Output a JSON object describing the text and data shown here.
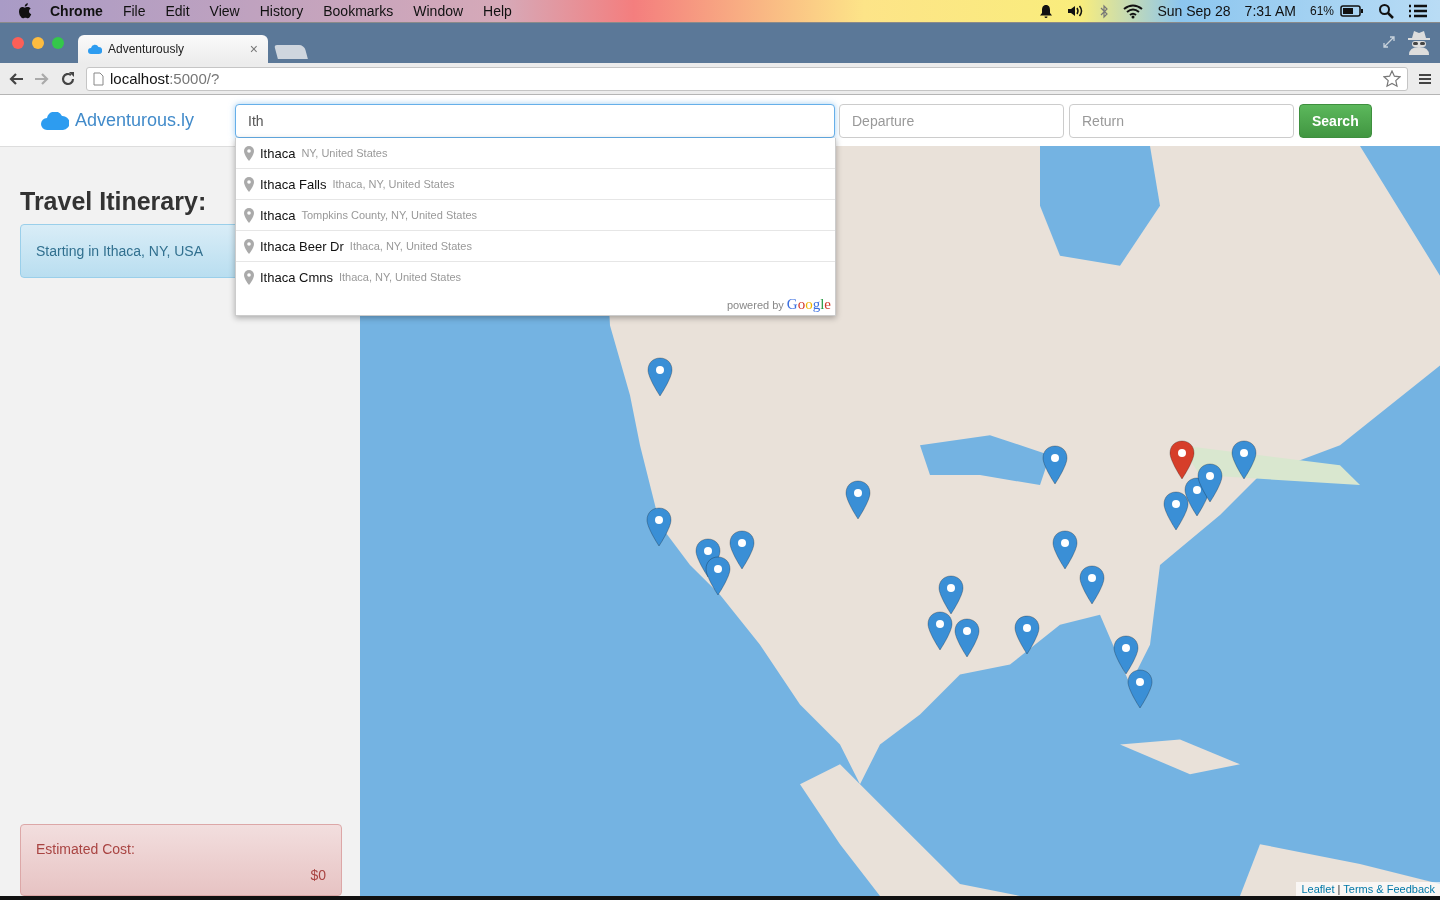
{
  "menu_bar": {
    "app": "Chrome",
    "items": [
      "File",
      "Edit",
      "View",
      "History",
      "Bookmarks",
      "Window",
      "Help"
    ],
    "date": "Sun Sep 28",
    "time": "7:31 AM",
    "battery": "61%"
  },
  "browser": {
    "tab": {
      "title": "Adventurously",
      "close": "×"
    },
    "url_host": "localhost",
    "url_path": ":5000/?"
  },
  "header": {
    "logo": "Adventurous.ly",
    "destination": {
      "value": "Ith"
    },
    "departure": {
      "placeholder": "Departure"
    },
    "return": {
      "placeholder": "Return"
    },
    "search_button": "Search"
  },
  "suggestions": {
    "items": [
      {
        "main": "Ithaca",
        "secondary": "NY, United States"
      },
      {
        "main": "Ithaca Falls",
        "secondary": "Ithaca, NY, United States"
      },
      {
        "main": "Ithaca",
        "secondary": "Tompkins County, NY, United States"
      },
      {
        "main": "Ithaca Beer Dr",
        "secondary": "Ithaca, NY, United States"
      },
      {
        "main": "Ithaca Cmns",
        "secondary": "Ithaca, NY, United States"
      }
    ],
    "powered_by": "powered by",
    "provider": "Google"
  },
  "itinerary": {
    "title": "Travel Itinerary:",
    "start": "Starting in Ithaca, NY, USA",
    "cost_label": "Estimated Cost:",
    "cost_value": "$0"
  },
  "map": {
    "markers": [
      {
        "color": "#3a8fd6"
      },
      {
        "color": "#3a8fd6"
      },
      {
        "color": "#3a8fd6"
      },
      {
        "color": "#3a8fd6"
      },
      {
        "color": "#3a8fd6"
      },
      {
        "color": "#3a8fd6"
      },
      {
        "color": "#3a8fd6"
      },
      {
        "color": "#3a8fd6"
      },
      {
        "color": "#3a8fd6"
      },
      {
        "color": "#3a8fd6"
      },
      {
        "color": "#3a8fd6"
      },
      {
        "color": "#3a8fd6"
      },
      {
        "color": "#3a8fd6"
      },
      {
        "color": "#3a8fd6"
      },
      {
        "color": "#3a8fd6"
      },
      {
        "color": "#3a8fd6"
      },
      {
        "color": "#3a8fd6"
      },
      {
        "color": "#3a8fd6"
      },
      {
        "color": "#3a8fd6"
      },
      {
        "color": "#d63e2a"
      }
    ],
    "attribution": {
      "links": [
        "Leaflet",
        "Terms & Feedback"
      ],
      "separator": "|"
    }
  }
}
